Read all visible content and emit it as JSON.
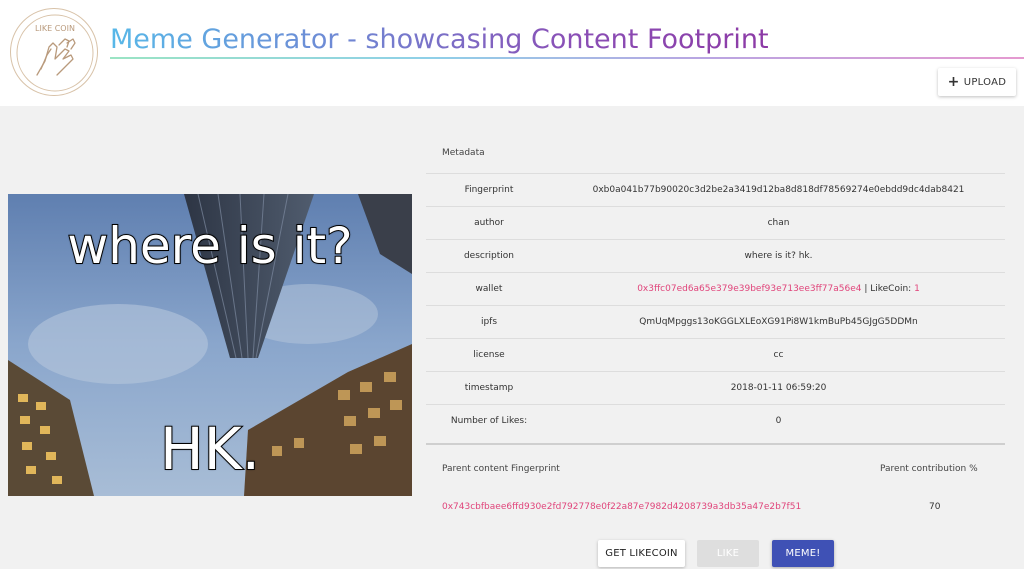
{
  "header": {
    "logo_text": "LIKE COIN",
    "title": "Meme Generator - showcasing Content Footprint",
    "upload_label": "UPLOAD"
  },
  "meme": {
    "top_text": "where is it?",
    "bottom_text": "HK."
  },
  "metadata": {
    "section_label": "Metadata",
    "rows": [
      {
        "key": "Fingerprint",
        "value": "0xb0a041b77b90020c3d2be2a3419d12ba8d818df78569274e0ebdd9dc4dab8421"
      },
      {
        "key": "author",
        "value": "chan"
      },
      {
        "key": "description",
        "value": "where is it? hk."
      },
      {
        "key": "wallet",
        "value": "0x3ffc07ed6a65e379e39bef93e713ee3ff77a56e4",
        "separator": " | LikeCoin: ",
        "likecoin": "1"
      },
      {
        "key": "ipfs",
        "value": "QmUqMpggs13oKGGLXLEoXG91Pi8W1kmBuPb45GJgG5DDMn"
      },
      {
        "key": "license",
        "value": "cc"
      },
      {
        "key": "timestamp",
        "value": "2018-01-11 06:59:20"
      },
      {
        "key": "Number of Likes:",
        "value": "0"
      }
    ]
  },
  "parent": {
    "fingerprint_header": "Parent content Fingerprint",
    "contribution_header": "Parent contribution %",
    "fingerprint": "0x743cbfbaee6ffd930e2fd792778e0f22a87e7982d4208739a3db35a47e2b7f51",
    "contribution": "70"
  },
  "actions": {
    "get_likecoin": "GET LIKECOIN",
    "like": "LIKE",
    "meme": "MEME!"
  },
  "colors": {
    "accent_blue": "#3f51b5",
    "link_pink": "#e0457b",
    "title_gradient_start": "#58b8e8",
    "title_gradient_end": "#8c3aa6"
  }
}
